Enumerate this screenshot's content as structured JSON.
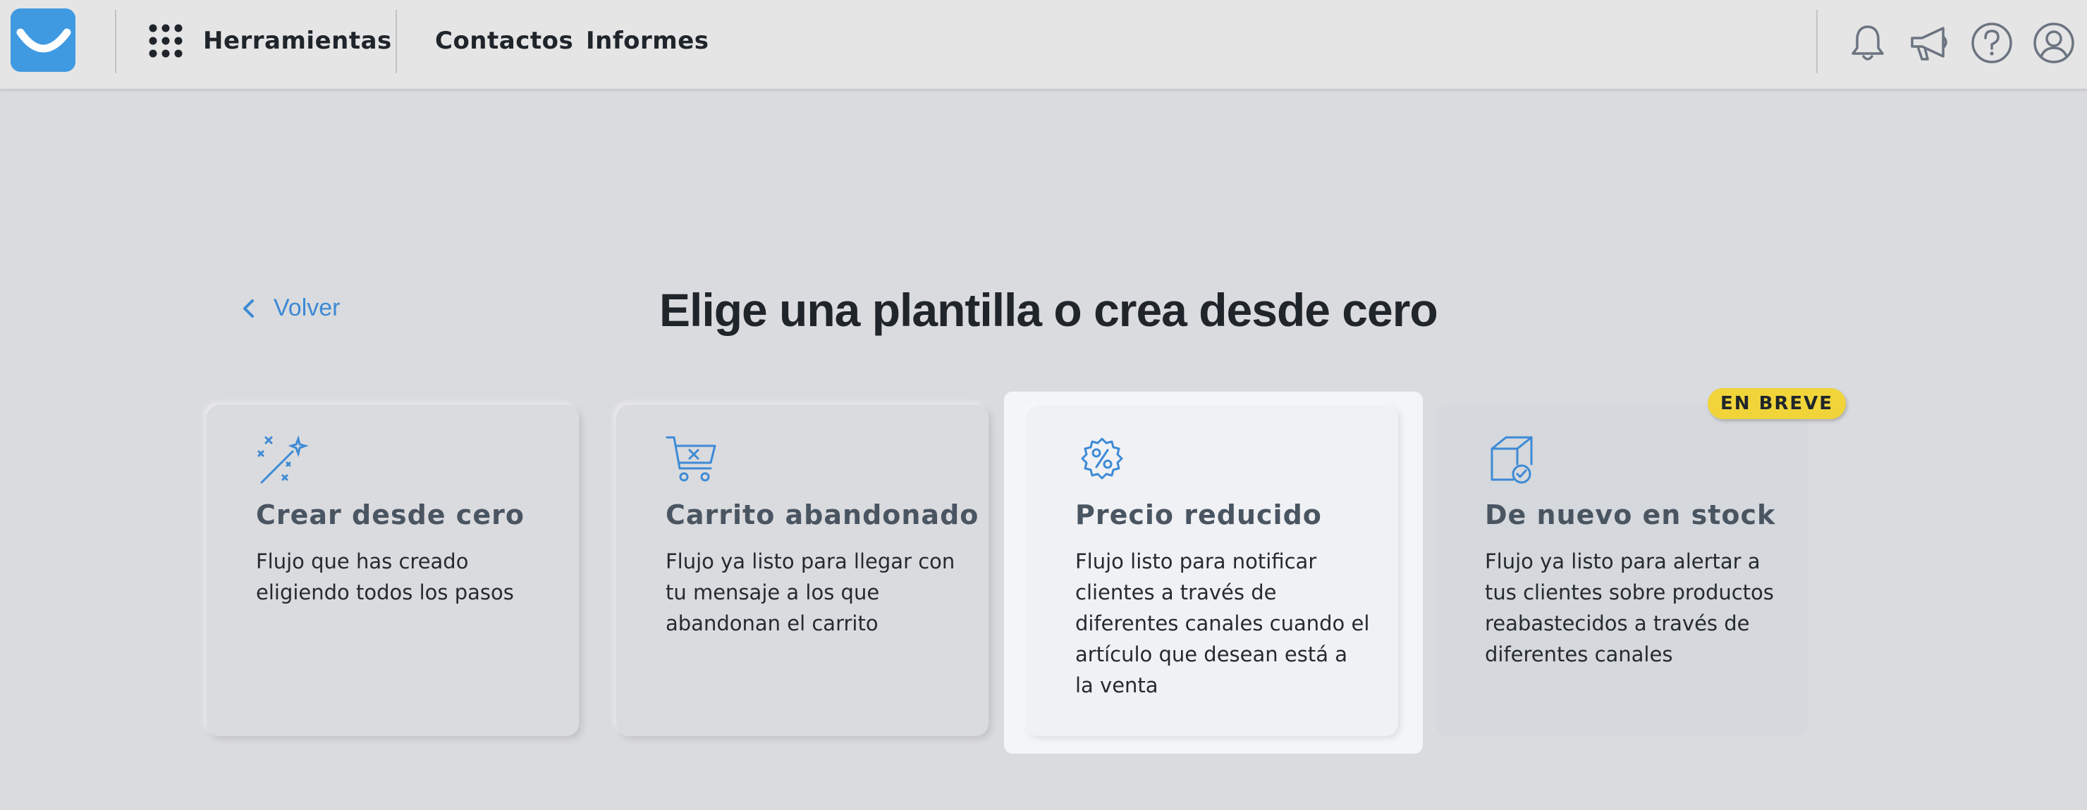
{
  "header": {
    "tools_label": "Herramientas",
    "nav": [
      {
        "label": "Contactos"
      },
      {
        "label": "Informes"
      }
    ],
    "icons": [
      "bell-icon",
      "megaphone-icon",
      "help-icon",
      "user-icon"
    ]
  },
  "main": {
    "back_label": "Volver",
    "title": "Elige una plantilla o crea desde cero",
    "cards": [
      {
        "icon": "magic-wand-icon",
        "title": "Crear desde cero",
        "description": "Flujo que has creado eligiendo todos los pasos"
      },
      {
        "icon": "cart-x-icon",
        "title": "Carrito abandonado",
        "description": "Flujo ya listo para llegar con tu mensaje a los que abandonan el carrito"
      },
      {
        "icon": "percent-badge-icon",
        "title": "Precio reducido",
        "description": "Flujo listo para notificar clientes a través de diferentes canales cuando el artículo que desean está a la venta"
      },
      {
        "icon": "box-check-icon",
        "title": "De nuevo en stock",
        "description": "Flujo ya listo para alertar a tus clientes sobre productos reabastecidos a través de diferentes canales",
        "badge": "EN BREVE"
      }
    ]
  },
  "colors": {
    "accent": "#3d8ad6",
    "logo": "#3f9ae2",
    "badge": "#f0d43a",
    "background": "#dadbde"
  }
}
